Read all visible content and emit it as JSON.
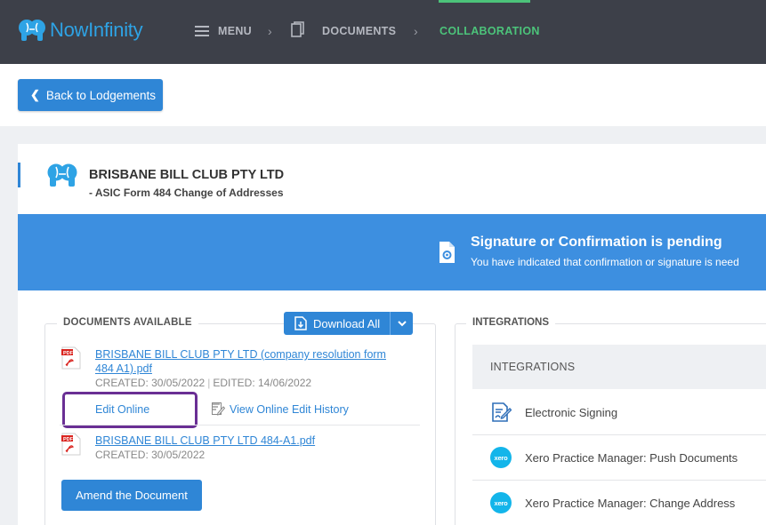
{
  "brand": {
    "name": "NowInfinity",
    "accent": "#2ea3e5"
  },
  "nav": {
    "menu_label": "MENU",
    "separator": "›",
    "documents_label": "DOCUMENTS",
    "collaboration_label": "COLLABORATION",
    "active": "COLLABORATION",
    "active_color": "#4cc37a"
  },
  "back_button": {
    "label": "Back to Lodgements"
  },
  "entity": {
    "name": "BRISBANE BILL CLUB PTY LTD",
    "form": "- ASIC Form 484 Change of Addresses"
  },
  "banner": {
    "title": "Signature or Confirmation is pending",
    "subtitle": "You have indicated that confirmation or signature is need",
    "color": "#3d8fe0"
  },
  "documents": {
    "section_label": "DOCUMENTS AVAILABLE",
    "download_all_label": "Download All",
    "items": [
      {
        "name_line1": "BRISBANE BILL CLUB PTY LTD (company resolution form",
        "name_line2": "484 A1).pdf",
        "created": "CREATED: 30/05/2022",
        "edited": "EDITED: 14/06/2022",
        "edit_online_label": "Edit Online",
        "history_label": "View Online Edit History"
      },
      {
        "name_line1": "BRISBANE BILL CLUB PTY LTD 484-A1.pdf",
        "created": "CREATED: 30/05/2022"
      }
    ],
    "amend_label": "Amend the Document",
    "pdf_icon_text": "PDF"
  },
  "integrations": {
    "section_label": "INTEGRATIONS",
    "header_label": "INTEGRATIONS",
    "items": [
      {
        "icon": "electronic-signing-icon",
        "label": "Electronic Signing"
      },
      {
        "icon": "xero-icon",
        "label": "Xero Practice Manager: Push Documents",
        "icon_text": "xero"
      },
      {
        "icon": "xero-icon",
        "label": "Xero Practice Manager: Change Address",
        "icon_text": "xero"
      }
    ]
  }
}
